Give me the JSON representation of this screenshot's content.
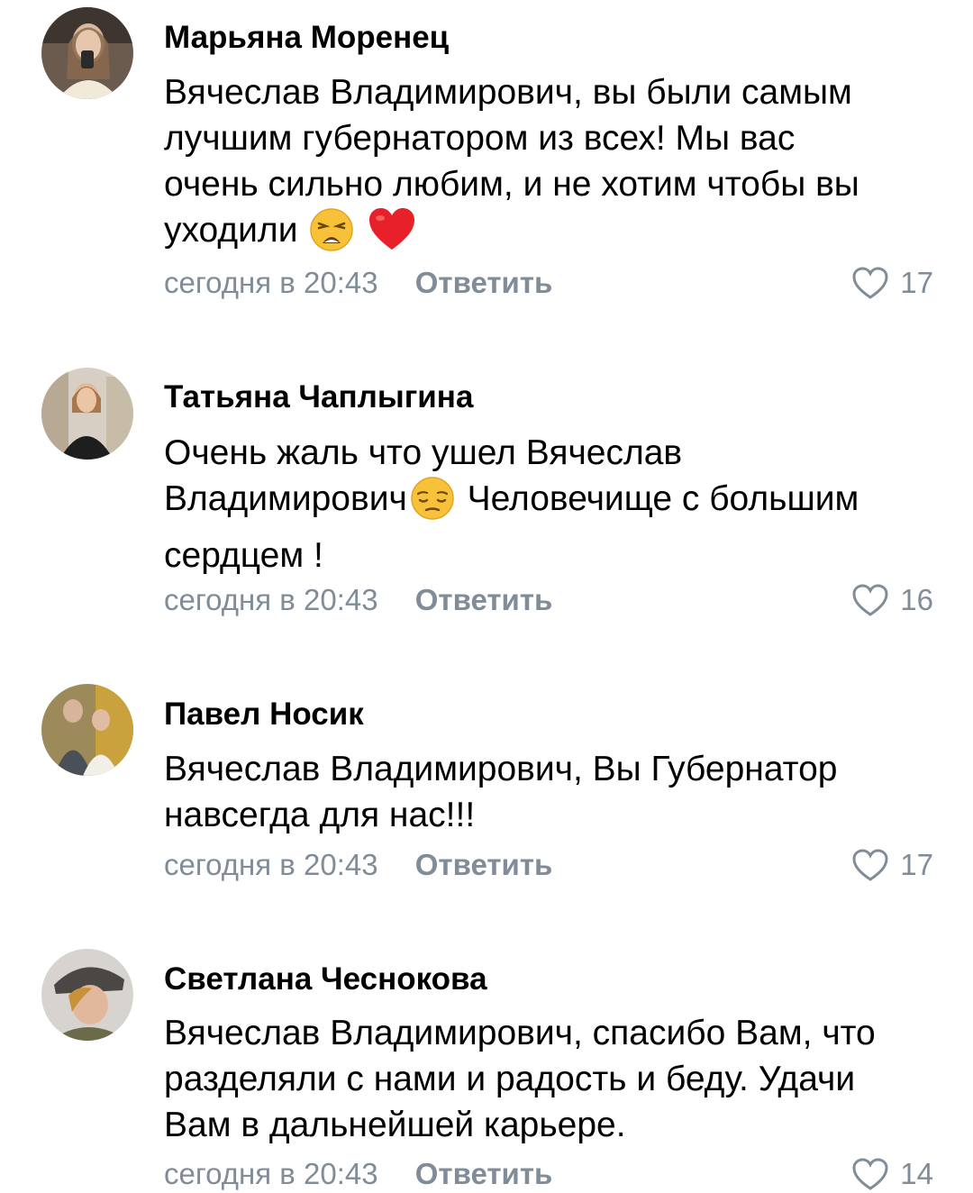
{
  "comments": [
    {
      "author": "Марьяна Моренец",
      "text_lines": [
        "Вячеслав Владимирович, вы были самым",
        "лучшим губернатором из всех! Мы вас",
        "очень сильно любим, и не хотим чтобы вы",
        "уходили"
      ],
      "emojis": [
        "weary-face-emoji",
        "red-heart-emoji"
      ],
      "time": "сегодня в 20:43",
      "reply": "Ответить",
      "likes": "17"
    },
    {
      "author": "Татьяна Чаплыгина",
      "text_line1": "Очень жаль что ушел Вячеслав",
      "text_line2a": "Владимирович",
      "text_line2b": " Человечище с большим",
      "text_line3": "сердцем !",
      "emojis": [
        "pensive-face-emoji"
      ],
      "time": "сегодня в 20:43",
      "reply": "Ответить",
      "likes": "16"
    },
    {
      "author": "Павел Носик",
      "text_lines": [
        "Вячеслав Владимирович, Вы Губернатор",
        "навсегда для нас!!!"
      ],
      "time": "сегодня в 20:43",
      "reply": "Ответить",
      "likes": "17"
    },
    {
      "author": "Светлана Чеснокова",
      "text_lines": [
        "Вячеслав Владимирович, спасибо Вам, что",
        "разделяли с нами и радость и беду. Удачи",
        "Вам в дальнейшей карьере."
      ],
      "time": "сегодня в 20:43",
      "reply": "Ответить",
      "likes": "14"
    }
  ],
  "colors": {
    "text": "#000000",
    "secondary": "#818c99",
    "background": "#ffffff"
  }
}
